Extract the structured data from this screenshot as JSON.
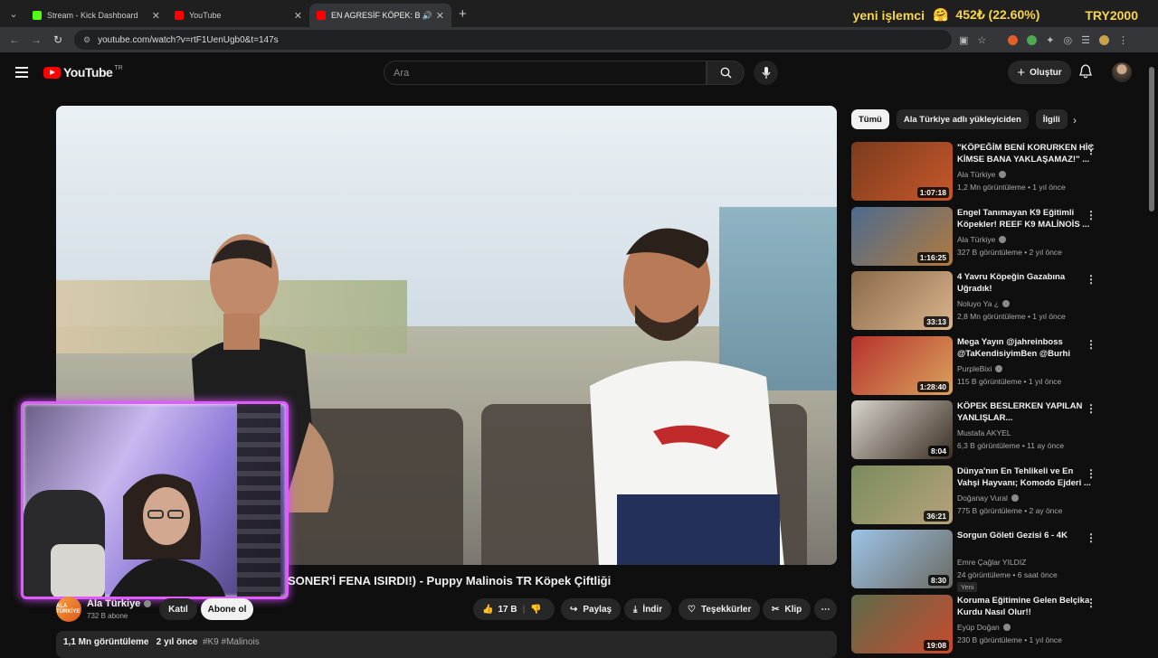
{
  "browser": {
    "tabs": [
      {
        "title": "Stream - Kick Dashboard",
        "favicon_color": "#53fc18",
        "active": false
      },
      {
        "title": "YouTube",
        "favicon_color": "#ff0000",
        "active": false
      },
      {
        "title": "EN AGRESİF KÖPEK: BELÇİK",
        "favicon_color": "#ff0000",
        "active": true
      }
    ],
    "url": "youtube.com/watch?v=rtF1UenUgb0&t=147s"
  },
  "ticker": {
    "label": "yeni işlemci",
    "emoji": "🤗",
    "value": "452₺ (22.60%)",
    "currency": "TRY2000"
  },
  "youtube": {
    "logo_text": "YouTube",
    "country_code": "TR",
    "search_placeholder": "Ara",
    "create_label": "Oluştur"
  },
  "video": {
    "title_visible": "SONER'İ FENA ISIRDI!) - Puppy Malinois TR Köpek Çiftliği",
    "channel_name": "Ala Türkiye",
    "channel_avatar_text": "ALA TÜRKİYE",
    "subscribers": "732 B abone",
    "join_label": "Katıl",
    "subscribe_label": "Abone ol",
    "likes": "17 B",
    "share_label": "Paylaş",
    "download_label": "İndir",
    "thanks_label": "Teşekkürler",
    "clip_label": "Klip",
    "views": "1,1 Mn görüntüleme",
    "age": "2 yıl önce",
    "tags": "#K9 #Malinois"
  },
  "chips": [
    {
      "label": "Tümü",
      "active": true
    },
    {
      "label": "Ala Türkiye adlı yükleyiciden",
      "active": false
    },
    {
      "label": "İlgili",
      "active": false
    }
  ],
  "recommendations": [
    {
      "title": "\"KÖPEĞİM BENİ KORURKEN HİÇ KİMSE BANA YAKLAŞAMAZ!\" ...",
      "channel": "Ala Türkiye",
      "verified": true,
      "meta": "1,2 Mn görüntüleme • 1 yıl önce",
      "duration": "1:07:18",
      "colors": [
        "#7b3c1e",
        "#c7572a"
      ],
      "new": ""
    },
    {
      "title": "Engel Tanımayan K9 Eğitimli Köpekler! REEF K9 MALİNOİS ...",
      "channel": "Ala Türkiye",
      "verified": true,
      "meta": "327 B görüntüleme • 2 yıl önce",
      "duration": "1:16:25",
      "colors": [
        "#4d6b8f",
        "#b0793e"
      ],
      "new": ""
    },
    {
      "title": "4 Yavru Köpeğin Gazabına Uğradık!",
      "channel": "Noluyo Ya ¿",
      "verified": true,
      "meta": "2,8 Mn görüntüleme • 1 yıl önce",
      "duration": "33:13",
      "colors": [
        "#8a6a4a",
        "#d9b48c"
      ],
      "new": ""
    },
    {
      "title": "Mega Yayın @jahreinboss @TaKendisiyimBen @Burhi",
      "channel": "PurpleBixi",
      "verified": true,
      "meta": "115 B görüntüleme • 1 yıl önce",
      "duration": "1:28:40",
      "colors": [
        "#b7322d",
        "#d9a25c"
      ],
      "new": ""
    },
    {
      "title": "KÖPEK BESLERKEN YAPILAN YANLIŞLAR...",
      "channel": "Mustafa AKYEL",
      "verified": false,
      "meta": "6,3 B görüntüleme • 11 ay önce",
      "duration": "8:04",
      "colors": [
        "#d8d4cc",
        "#3a2e22"
      ],
      "new": ""
    },
    {
      "title": "Dünya'nın En Tehlikeli ve En Vahşi Hayvanı; Komodo Ejderi ...",
      "channel": "Doğanay Vural",
      "verified": true,
      "meta": "775 B görüntüleme • 2 ay önce",
      "duration": "36:21",
      "colors": [
        "#7a8c5e",
        "#b6a27a"
      ],
      "new": ""
    },
    {
      "title": "Sorgun Göleti Gezisi 6 - 4K",
      "channel": "Emre Çağlar YILDIZ",
      "verified": false,
      "meta": "24 görüntüleme • 6 saat önce",
      "duration": "8:30",
      "colors": [
        "#9cc3e6",
        "#6b6a63"
      ],
      "new": "Yeni"
    },
    {
      "title": "Koruma Eğitimine Gelen Belçika Kurdu Nasıl Olur!!",
      "channel": "Eyüp Doğan",
      "verified": true,
      "meta": "230 B görüntüleme • 1 yıl önce",
      "duration": "19:08",
      "colors": [
        "#5d6b4a",
        "#c94a2e"
      ],
      "new": ""
    }
  ],
  "colors": {
    "accent": "#ff0000",
    "overlay_border": "#e05cff"
  }
}
